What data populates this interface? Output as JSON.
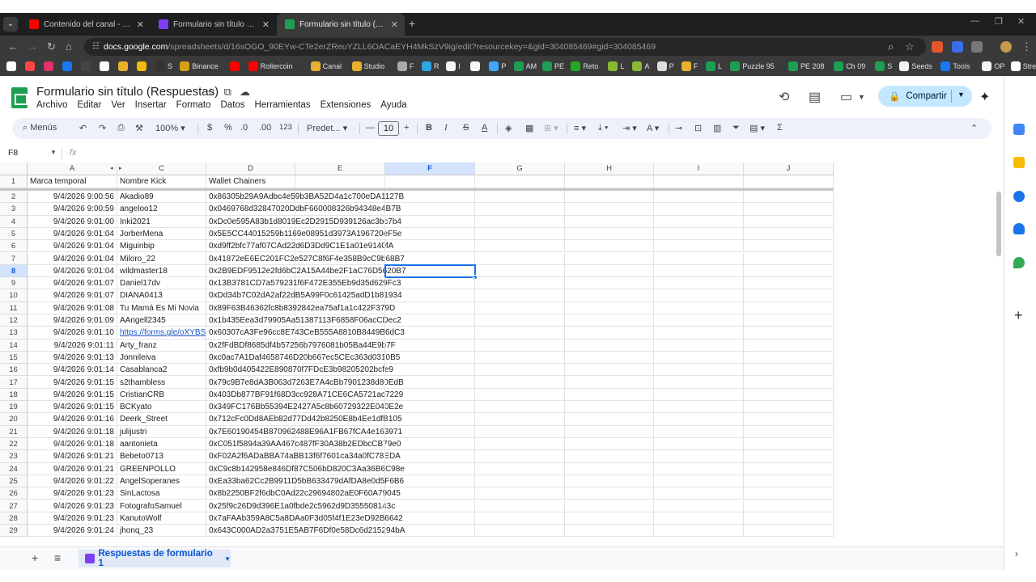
{
  "browser": {
    "tabs": [
      {
        "title": "Contenido del canal - YouTube",
        "favicon_color": "#ff0000",
        "active": false
      },
      {
        "title": "Formulario sin título - Formular",
        "favicon_color": "#7e3ff2",
        "active": false
      },
      {
        "title": "Formulario sin título (Respuest",
        "favicon_color": "#1e9e52",
        "active": true
      }
    ],
    "url_domain": "docs.google.com",
    "url_path": "/spreadsheets/d/16sOGO_90EYw-CTe2erZReuYZLL6OACaEYH4MkSzV9ig/edit?resourcekey=&gid=304085469#gid=304085469",
    "bookmarks": [
      "",
      "",
      "",
      "",
      "",
      "",
      "",
      "",
      "S",
      "Binance",
      "",
      "Rollercoin",
      "Canal",
      "Studio",
      "F",
      "R",
      "I",
      "",
      "P",
      "AM",
      "PE",
      "Reto",
      "L",
      "A",
      "P",
      "F",
      "L",
      "Puzzle 95",
      "PE 208",
      "Ch 09",
      "S",
      "Seeds",
      "Tools",
      "OP",
      "Stream"
    ]
  },
  "sheets": {
    "title": "Formulario sin título (Respuestas)",
    "menu": [
      "Archivo",
      "Editar",
      "Ver",
      "Insertar",
      "Formato",
      "Datos",
      "Herramientas",
      "Extensiones",
      "Ayuda"
    ],
    "share_label": "Compartir",
    "toolbar": {
      "menus_label": "Menús",
      "zoom": "100%",
      "currency": "$",
      "percent": "%",
      "dec_less": ".0",
      "dec_more": ".00",
      "number_format": "123",
      "font": "Predet...",
      "font_size": "10"
    },
    "name_box": "F8",
    "fx": "fx",
    "columns": [
      "A",
      "B",
      "C",
      "D",
      "E",
      "F",
      "G",
      "H",
      "I",
      "J"
    ],
    "header_row": {
      "a": "Marca temporal",
      "c": "Nombre Kick",
      "d": "Wallet Chainers"
    },
    "rows": [
      {
        "n": "2",
        "ts": "9/4/2026 9:00:56",
        "name": "Akadio89",
        "wallet": "0x86305b29A9Adbc4e59b3BA52D4a1c700eDA1127B"
      },
      {
        "n": "3",
        "ts": "9/4/2026 9:00:59",
        "name": "angeloo12",
        "wallet": "0x0469768d32847020DdbF660008326b94348e4B7B"
      },
      {
        "n": "4",
        "ts": "9/4/2026 9:01:00",
        "name": "Inki2021",
        "wallet": "0xDc0e595A83b1d8019Ec2D2915D939126ac3bc7b4"
      },
      {
        "n": "5",
        "ts": "9/4/2026 9:01:04",
        "name": "JorberMena",
        "wallet": "0x5E5CC44015259b1169e08951d3973A196720eF5e"
      },
      {
        "n": "6",
        "ts": "9/4/2026 9:01:04",
        "name": "Miguinbip",
        "wallet": "0xd9ff2bfc77af07CAd22d6D3Dd9C1E1a01e9140fA"
      },
      {
        "n": "7",
        "ts": "9/4/2026 9:01:04",
        "name": "Miloro_22",
        "wallet": "0x41872eE6EC201FC2e527C8f6F4e358B9cC9b68B7"
      },
      {
        "n": "8",
        "ts": "9/4/2026 9:01:04",
        "name": "wildmaster18",
        "wallet": "0x2B9EDF9512e2fd6bC2A15A44be2F1aC76D5620B7"
      },
      {
        "n": "9",
        "ts": "9/4/2026 9:01:07",
        "name": "Daniel17dv",
        "wallet": "0x13B3781CD7a579231f6F472E355Eb9d35d629Fc3"
      },
      {
        "n": "10",
        "ts": "9/4/2026 9:01:07",
        "name": "DIANA0413",
        "wallet": "0xDd34b7C02dA2af22dB5A99F0c61425adD1b81934"
      },
      {
        "n": "11",
        "ts": "9/4/2026 9:01:08",
        "name": "Tu Mamá Es Mi Novia",
        "wallet": "0x89F63B46362fc8b8392842ea75af1a1c422F379D"
      },
      {
        "n": "12",
        "ts": "9/4/2026 9:01:09",
        "name": "AAngell2345",
        "wallet": "0x1b435Eea3d79905Aa51387113F6858F06acCDec2"
      },
      {
        "n": "13",
        "ts": "9/4/2026 9:01:10",
        "name": "https://forms.gle/oXYBSr",
        "wallet": "0x60307cA3Fe96cc8E743CeB555A8810B8449B6dC3",
        "link": true
      },
      {
        "n": "14",
        "ts": "9/4/2026 9:01:11",
        "name": "Arty_franz",
        "wallet": "0x2fFdBDf8685df4b57256b7976081b05Ba44E9b7F"
      },
      {
        "n": "15",
        "ts": "9/4/2026 9:01:13",
        "name": "Jonnileiva",
        "wallet": "0xc0ac7A1Daf4658746D20b667ec5CEc363d0310B5"
      },
      {
        "n": "16",
        "ts": "9/4/2026 9:01:14",
        "name": "Casablanca2",
        "wallet": "0xfb9b0d405422E890870f7FDcE3b98205202bcfe9"
      },
      {
        "n": "17",
        "ts": "9/4/2026 9:01:15",
        "name": "s2thambless",
        "wallet": "0x79c9B7e8dA3B063d7263E7A4cBb7901238d80EdB"
      },
      {
        "n": "18",
        "ts": "9/4/2026 9:01:15",
        "name": "CristianCRB",
        "wallet": "0x403Db877BF91f68D3cc928A71CE6CA5721ac7229"
      },
      {
        "n": "19",
        "ts": "9/4/2026 9:01:15",
        "name": "BCKyato",
        "wallet": "0x349FC176Bb55394E2427A5c8b60729322E040E2e"
      },
      {
        "n": "20",
        "ts": "9/4/2026 9:01:16",
        "name": "Deerk_Street",
        "wallet": "0x712cFc0Dd8AEb82d77Dd42b8250E8b4Ee1dfB105"
      },
      {
        "n": "21",
        "ts": "9/4/2026 9:01:18",
        "name": "julijustri",
        "wallet": "0x7E60190454B870962488E96A1FB67fCA4e163971"
      },
      {
        "n": "22",
        "ts": "9/4/2026 9:01:18",
        "name": "aantonieta",
        "wallet": "0xC051f5894a39AA467c487fF30A38b2EDbcCB79e0"
      },
      {
        "n": "23",
        "ts": "9/4/2026 9:01:21",
        "name": "Bebeto0713",
        "wallet": "0xF02A2f6ADaBBA74aBB13f6f7601ca34a0fC78EDA"
      },
      {
        "n": "24",
        "ts": "9/4/2026 9:01:21",
        "name": "GREENPOLLO",
        "wallet": "0xC9c8b142958e846Df87C506bD820C3Aa36B6C98e"
      },
      {
        "n": "25",
        "ts": "9/4/2026 9:01:22",
        "name": "AngelSoperanes",
        "wallet": "0xEa33ba62Cc2B9911D5bB633479dAfDA8e0d5F6B6"
      },
      {
        "n": "26",
        "ts": "9/4/2026 9:01:23",
        "name": "SinLactosa",
        "wallet": "0x8b2250BF2f6dbC0Ad22c29694802aE0F60A79045"
      },
      {
        "n": "27",
        "ts": "9/4/2026 9:01:23",
        "name": "FotografoSamuel",
        "wallet": "0x25f9c26D9d396E1a0fbde2c5962d9D355508143c"
      },
      {
        "n": "28",
        "ts": "9/4/2026 9:01:23",
        "name": "KanutoWolf",
        "wallet": "0x7aFAAb359A8C5a8DAa0F3d05f4f1E23eD92B6642"
      },
      {
        "n": "29",
        "ts": "9/4/2026 9:01:24",
        "name": "jhonq_23",
        "wallet": "0x643C000AD2a3751E5AB7F6Df0e58Dc6d215294bA"
      }
    ],
    "selected_cell": "F8",
    "sheet_tab": "Respuestas de formulario 1"
  },
  "colors": {
    "accent": "#1a73e8",
    "share_bg": "#c2e7ff",
    "sheets_green": "#1e9e52"
  }
}
